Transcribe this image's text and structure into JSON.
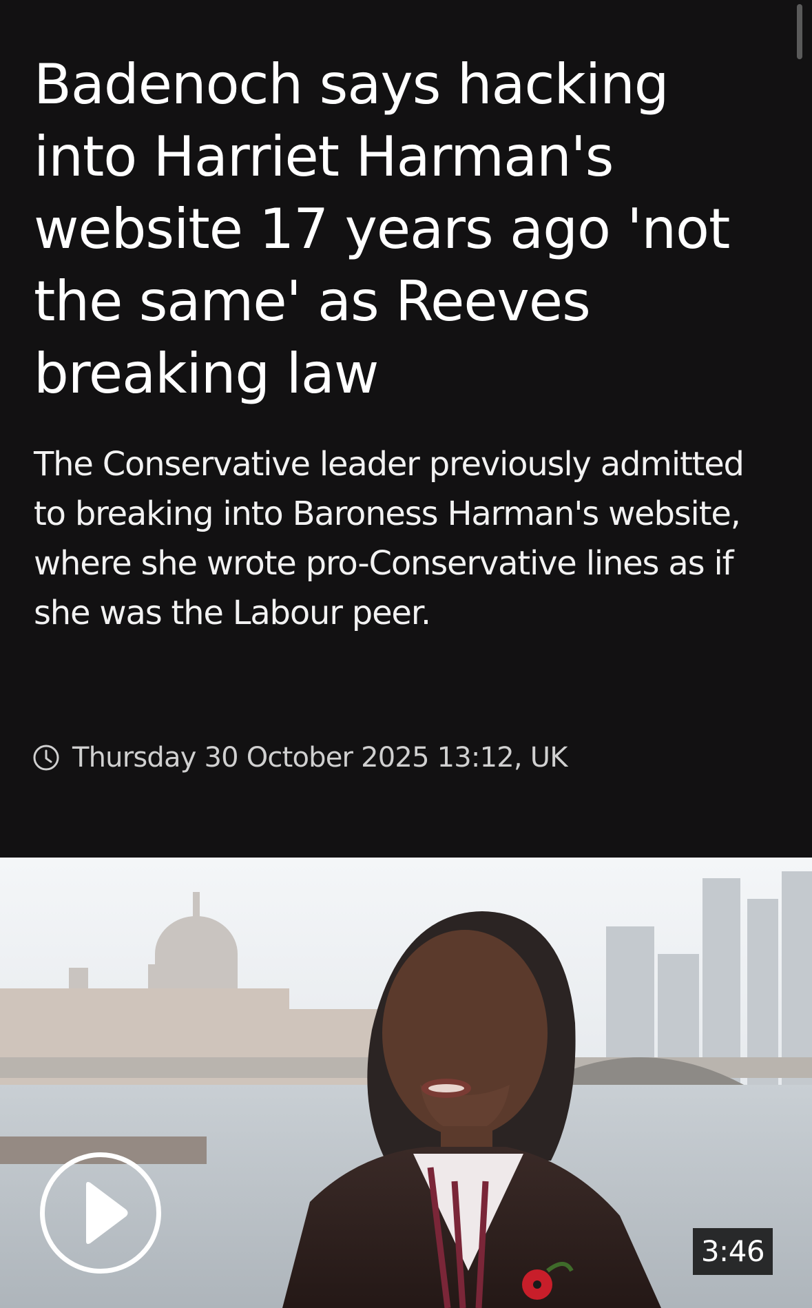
{
  "article": {
    "headline": "Badenoch says hacking into Harriet Harman's website 17 years ago 'not the same' as Reeves breaking law",
    "standfirst": "The Conservative leader previously admitted to breaking into Baroness Harman's website, where she wrote pro-Conservative lines as if she was the Labour peer.",
    "timestamp": "Thursday 30 October 2025 13:12, UK",
    "timestamp_icon": "clock-icon"
  },
  "video": {
    "duration": "3:46",
    "play_icon": "play-icon"
  },
  "colors": {
    "background": "#121112",
    "text": "#ffffff",
    "meta_text": "#d0d0d0"
  }
}
